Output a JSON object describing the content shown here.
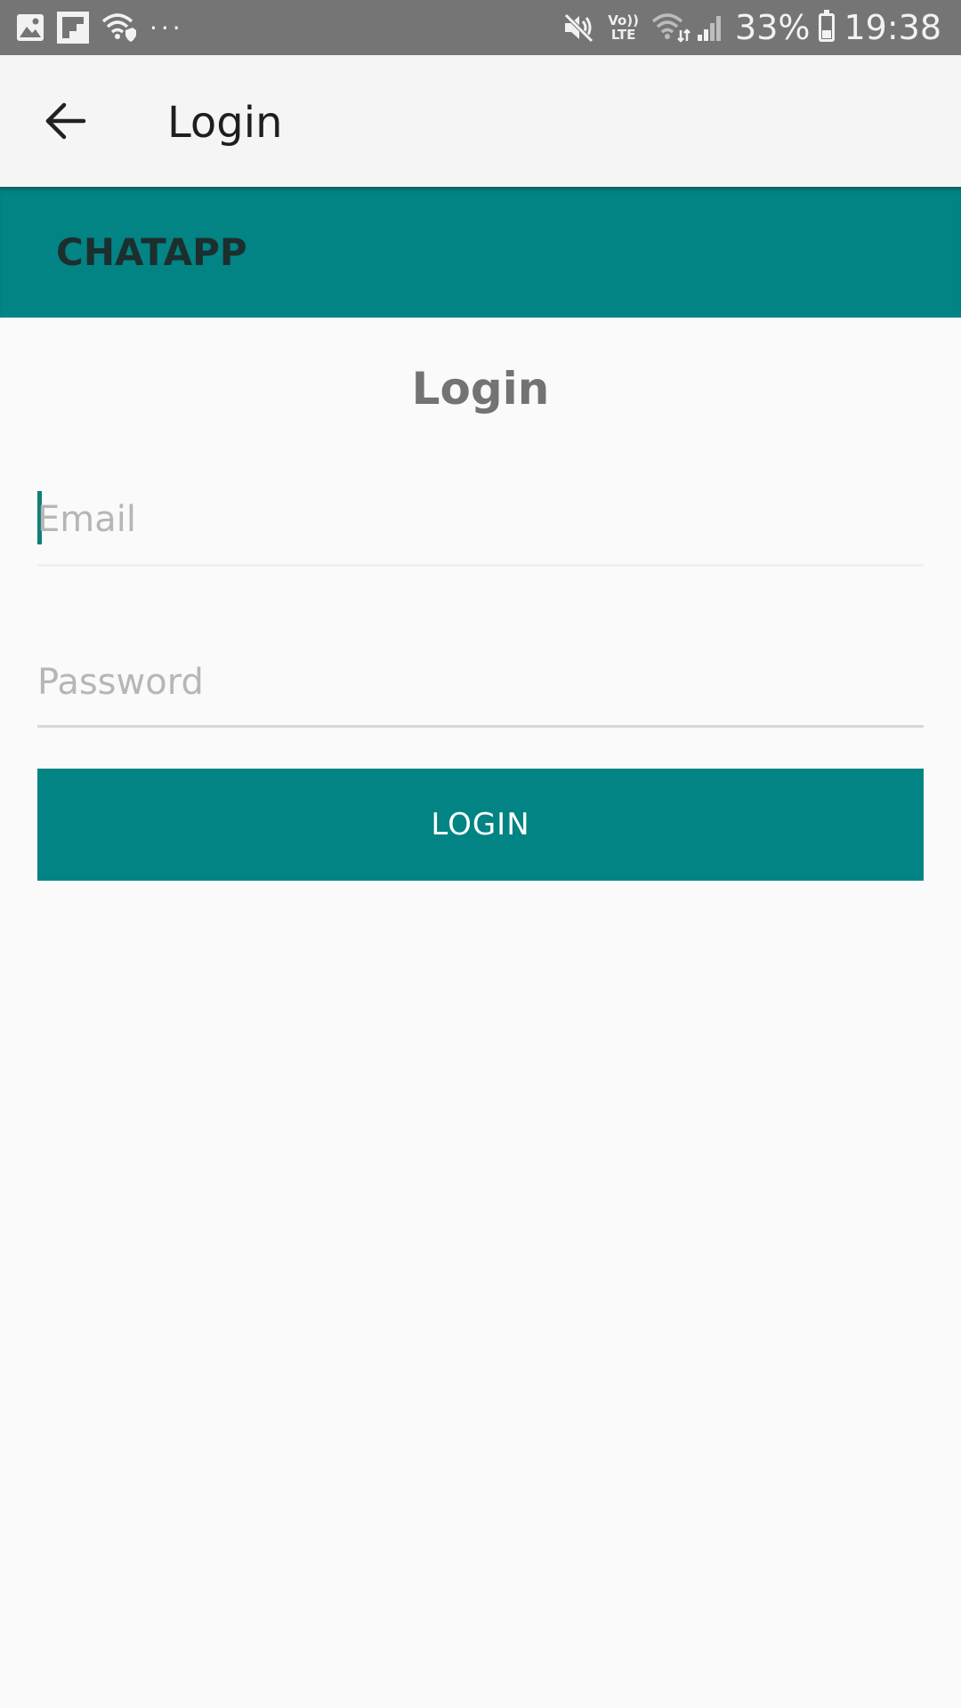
{
  "status_bar": {
    "battery": "33%",
    "battery_level": 0.33,
    "time": "19:38",
    "network_top": "Vo))",
    "network_bottom": "LTE",
    "overflow": "···"
  },
  "app_bar": {
    "back_icon": "arrow-left-icon",
    "title": "Login"
  },
  "brand_bar": {
    "title": "CHATAPP"
  },
  "form": {
    "title": "Login",
    "email": {
      "value": "",
      "placeholder": "Email"
    },
    "password": {
      "value": "",
      "placeholder": "Password"
    },
    "login_button": "LOGIN"
  },
  "colors": {
    "status_bar": "#757575",
    "app_bar": "#f5f5f5",
    "primary": "#028484",
    "background": "#fafafa",
    "caret": "#0f7f78"
  }
}
